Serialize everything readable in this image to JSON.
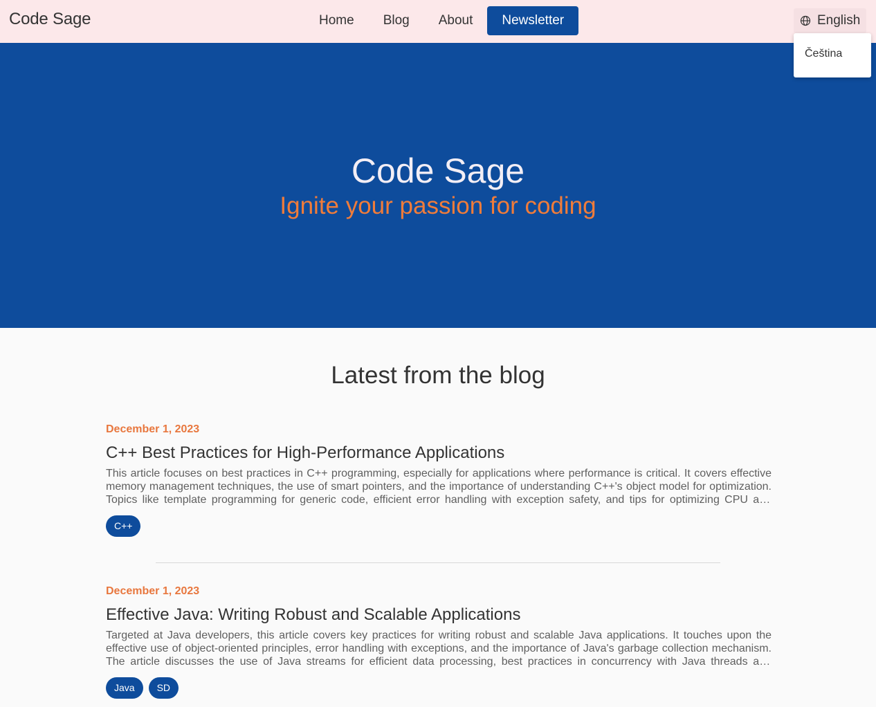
{
  "header": {
    "brand": "Code Sage",
    "nav": [
      "Home",
      "Blog",
      "About"
    ],
    "cta": "Newsletter",
    "language": {
      "current": "English",
      "options": [
        "Čeština"
      ]
    }
  },
  "hero": {
    "title": "Code Sage",
    "subtitle": "Ignite your passion for coding"
  },
  "blog": {
    "heading": "Latest from the blog",
    "posts": [
      {
        "date": "December 1, 2023",
        "title": "C++ Best Practices for High-Performance Applications",
        "excerpt": "This article focuses on best practices in C++ programming, especially for applications where performance is critical. It covers effective memory management techniques, the use of smart pointers, and the importance of understanding C++'s object model for optimization. Topics like template programming for generic code, efficient error handling with exception safety, and tips for optimizing CPU and memory usage are also discussed.",
        "tags": [
          "C++"
        ]
      },
      {
        "date": "December 1, 2023",
        "title": "Effective Java: Writing Robust and Scalable Applications",
        "excerpt": "Targeted at Java developers, this article covers key practices for writing robust and scalable Java applications. It touches upon the effective use of object-oriented principles, error handling with exceptions, and the importance of Java's garbage collection mechanism. The article discusses the use of Java streams for efficient data processing, best practices in concurrency with Java threads and executors.",
        "tags": [
          "Java",
          "SD"
        ]
      }
    ]
  },
  "colors": {
    "header_bg": "#fce8ea",
    "primary": "#0e4c9c",
    "accent": "#f07c3a",
    "hero_title": "#f3eef5"
  }
}
